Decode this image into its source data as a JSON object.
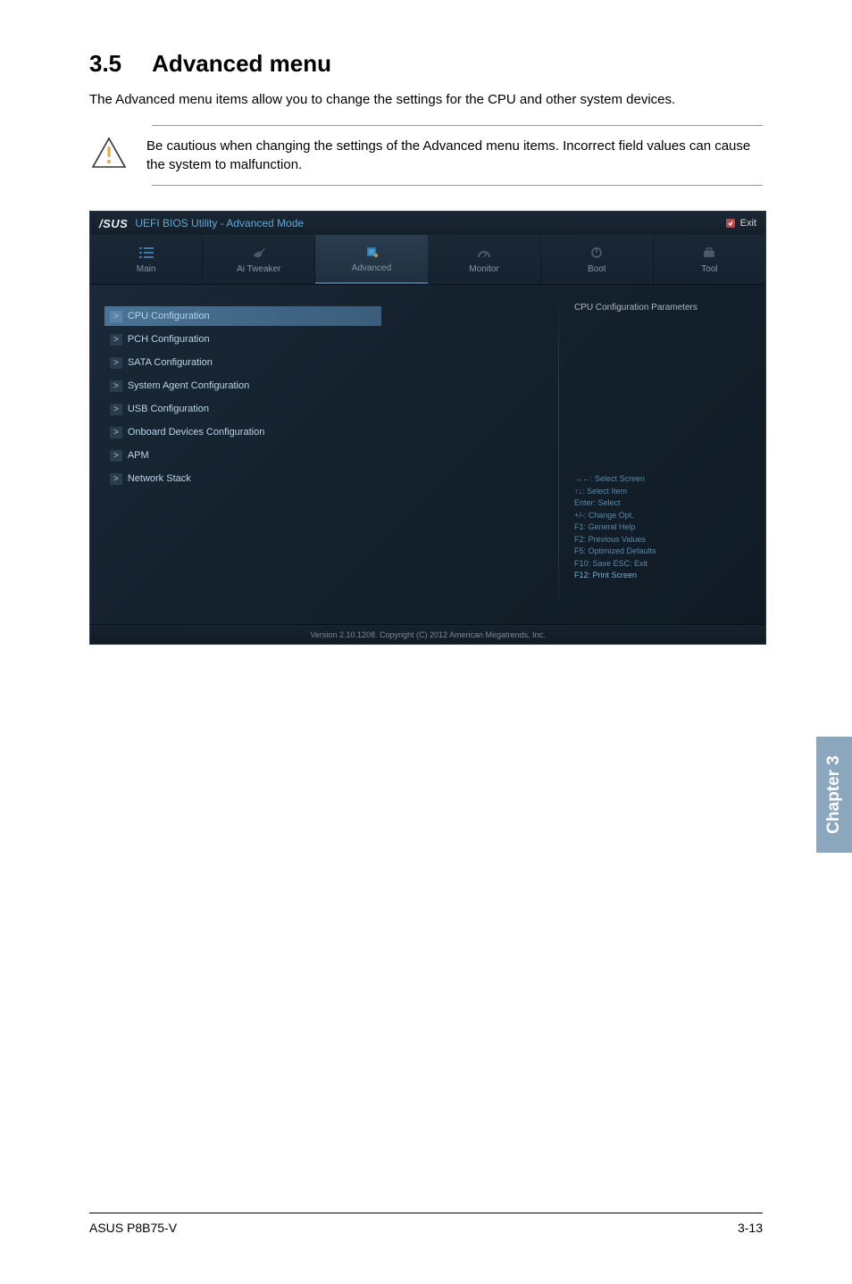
{
  "heading": {
    "num": "3.5",
    "title": "Advanced menu"
  },
  "intro": "The Advanced menu items allow you to change the settings for the CPU and other system devices.",
  "caution": "Be cautious when changing the settings of the Advanced menu items. Incorrect field values can cause the system to malfunction.",
  "bios": {
    "brand": "/SUS",
    "title": "UEFI BIOS Utility - Advanced Mode",
    "exit": "Exit",
    "tabs": [
      {
        "label": "Main"
      },
      {
        "label": "Ai  Tweaker"
      },
      {
        "label": "Advanced"
      },
      {
        "label": "Monitor"
      },
      {
        "label": "Boot"
      },
      {
        "label": "Tool"
      }
    ],
    "menu_items": [
      "CPU Configuration",
      "PCH Configuration",
      "SATA Configuration",
      "System Agent Configuration",
      "USB Configuration",
      "Onboard Devices Configuration",
      "APM",
      "Network Stack"
    ],
    "right_heading": "CPU Configuration Parameters",
    "help_lines": [
      "→←:  Select Screen",
      "↑↓:  Select Item",
      "Enter:  Select",
      "+/-:  Change Opt.",
      "F1:  General Help",
      "F2:  Previous Values",
      "F5:  Optimized Defaults",
      "F10:  Save   ESC:  Exit",
      "F12: Print Screen"
    ],
    "footer": "Version  2.10.1208.   Copyright  (C)  2012  American  Megatrends,  Inc."
  },
  "chapter_tab": "Chapter 3",
  "page_footer_left": "ASUS P8B75-V",
  "page_footer_right": "3-13"
}
